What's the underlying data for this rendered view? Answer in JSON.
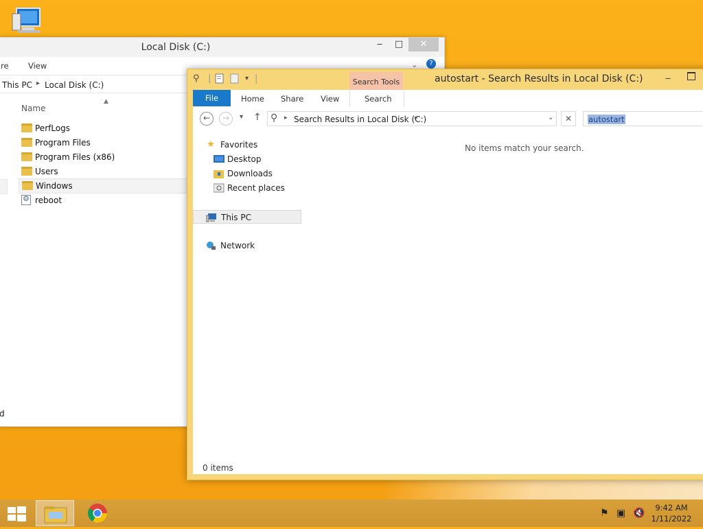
{
  "desktop": {
    "icon_name": "this-pc-icon"
  },
  "back_window": {
    "title": "Local Disk (C:)",
    "minimize": "‒",
    "maximize": "□",
    "close": "✕",
    "ribbon": {
      "tab_share_partial": "re",
      "tab_view": "View"
    },
    "address": {
      "segment1": "This PC",
      "separator": "▸",
      "segment2": "Local Disk (C:)"
    },
    "column_header": "Name",
    "items": [
      "PerfLogs",
      "Program Files",
      "Program Files (x86)",
      "Users",
      "Windows",
      "reboot"
    ],
    "partial_status": "d"
  },
  "front_window": {
    "title": "autostart - Search Results in Local Disk (C:)",
    "contextual_tab_group": "Search Tools",
    "tabs": {
      "file": "File",
      "home": "Home",
      "share": "Share",
      "view": "View",
      "search": "Search"
    },
    "address": {
      "path": "Search Results in Local Disk (C:)"
    },
    "search_value": "autostart",
    "nav": {
      "favorites": "Favorites",
      "desktop": "Desktop",
      "downloads": "Downloads",
      "recent": "Recent places",
      "this_pc": "This PC",
      "network": "Network"
    },
    "empty_message": "No items match your search.",
    "status": "0 items"
  },
  "taskbar": {
    "clock_time": "9:42 AM",
    "clock_date": "1/11/2022"
  },
  "colors": {
    "desktop": "#f6a413",
    "active_frame": "#f7d67a",
    "file_tab": "#1979ca",
    "search_tools": "#f6c2a8",
    "selection": "#9ab7e6"
  }
}
